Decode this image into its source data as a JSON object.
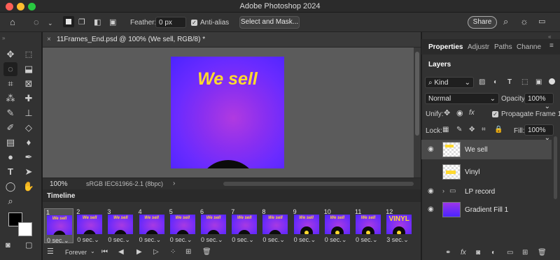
{
  "window": {
    "title": "Adobe Photoshop 2024"
  },
  "options_bar": {
    "feather_label": "Feather:",
    "feather_value": "0 px",
    "anti_alias_label": "Anti-alias",
    "select_mask_label": "Select and Mask...",
    "share_label": "Share"
  },
  "document": {
    "tab_title": "11Frames_End.psd @ 100% (We sell, RGB/8) *",
    "artboard_text": "We sell",
    "zoom": "100%",
    "color_profile": "sRGB IEC61966-2.1 (8bpc)"
  },
  "timeline": {
    "title": "Timeline",
    "loop_label": "Forever",
    "frames": [
      {
        "num": "1",
        "delay": "0 sec.",
        "thumb": "We sell",
        "dot": false
      },
      {
        "num": "2",
        "delay": "0 sec.",
        "thumb": "We sell",
        "dot": false
      },
      {
        "num": "3",
        "delay": "0 sec.",
        "thumb": "We sell",
        "dot": false
      },
      {
        "num": "4",
        "delay": "0 sec.",
        "thumb": "We sell",
        "dot": false
      },
      {
        "num": "5",
        "delay": "0 sec.",
        "thumb": "We sell",
        "dot": false
      },
      {
        "num": "6",
        "delay": "0 sec.",
        "thumb": "We sell",
        "dot": false
      },
      {
        "num": "7",
        "delay": "0 sec.",
        "thumb": "We sell",
        "dot": false
      },
      {
        "num": "8",
        "delay": "0 sec.",
        "thumb": "We sell",
        "dot": false
      },
      {
        "num": "9",
        "delay": "0 sec.",
        "thumb": "We sell",
        "dot": true
      },
      {
        "num": "10",
        "delay": "0 sec.",
        "thumb": "We sell",
        "dot": true
      },
      {
        "num": "11",
        "delay": "0 sec.",
        "thumb": "We sell",
        "dot": true
      },
      {
        "num": "12",
        "delay": "3 sec.",
        "thumb": "VINYL",
        "dot": true
      }
    ]
  },
  "panels": {
    "tabs": [
      "Properties",
      "Adjustr",
      "Paths",
      "Channe"
    ],
    "layers_title": "Layers",
    "filter_kind": "Kind",
    "blend_mode": "Normal",
    "opacity_label": "Opacity:",
    "opacity_value": "100%",
    "unify_label": "Unify:",
    "propagate_label": "Propagate Frame 1",
    "lock_label": "Lock:",
    "fill_label": "Fill:",
    "fill_value": "100%",
    "layers": [
      {
        "name": "We sell",
        "selected": true,
        "visible": true
      },
      {
        "name": "Vinyl",
        "selected": false,
        "visible": false
      },
      {
        "name": "LP record",
        "selected": false,
        "visible": true
      },
      {
        "name": "Gradient Fill 1",
        "selected": false,
        "visible": true
      }
    ]
  },
  "colors": {
    "accent": "#6a2bff",
    "headline": "#ffd92e",
    "record": "#0b0b0b"
  }
}
